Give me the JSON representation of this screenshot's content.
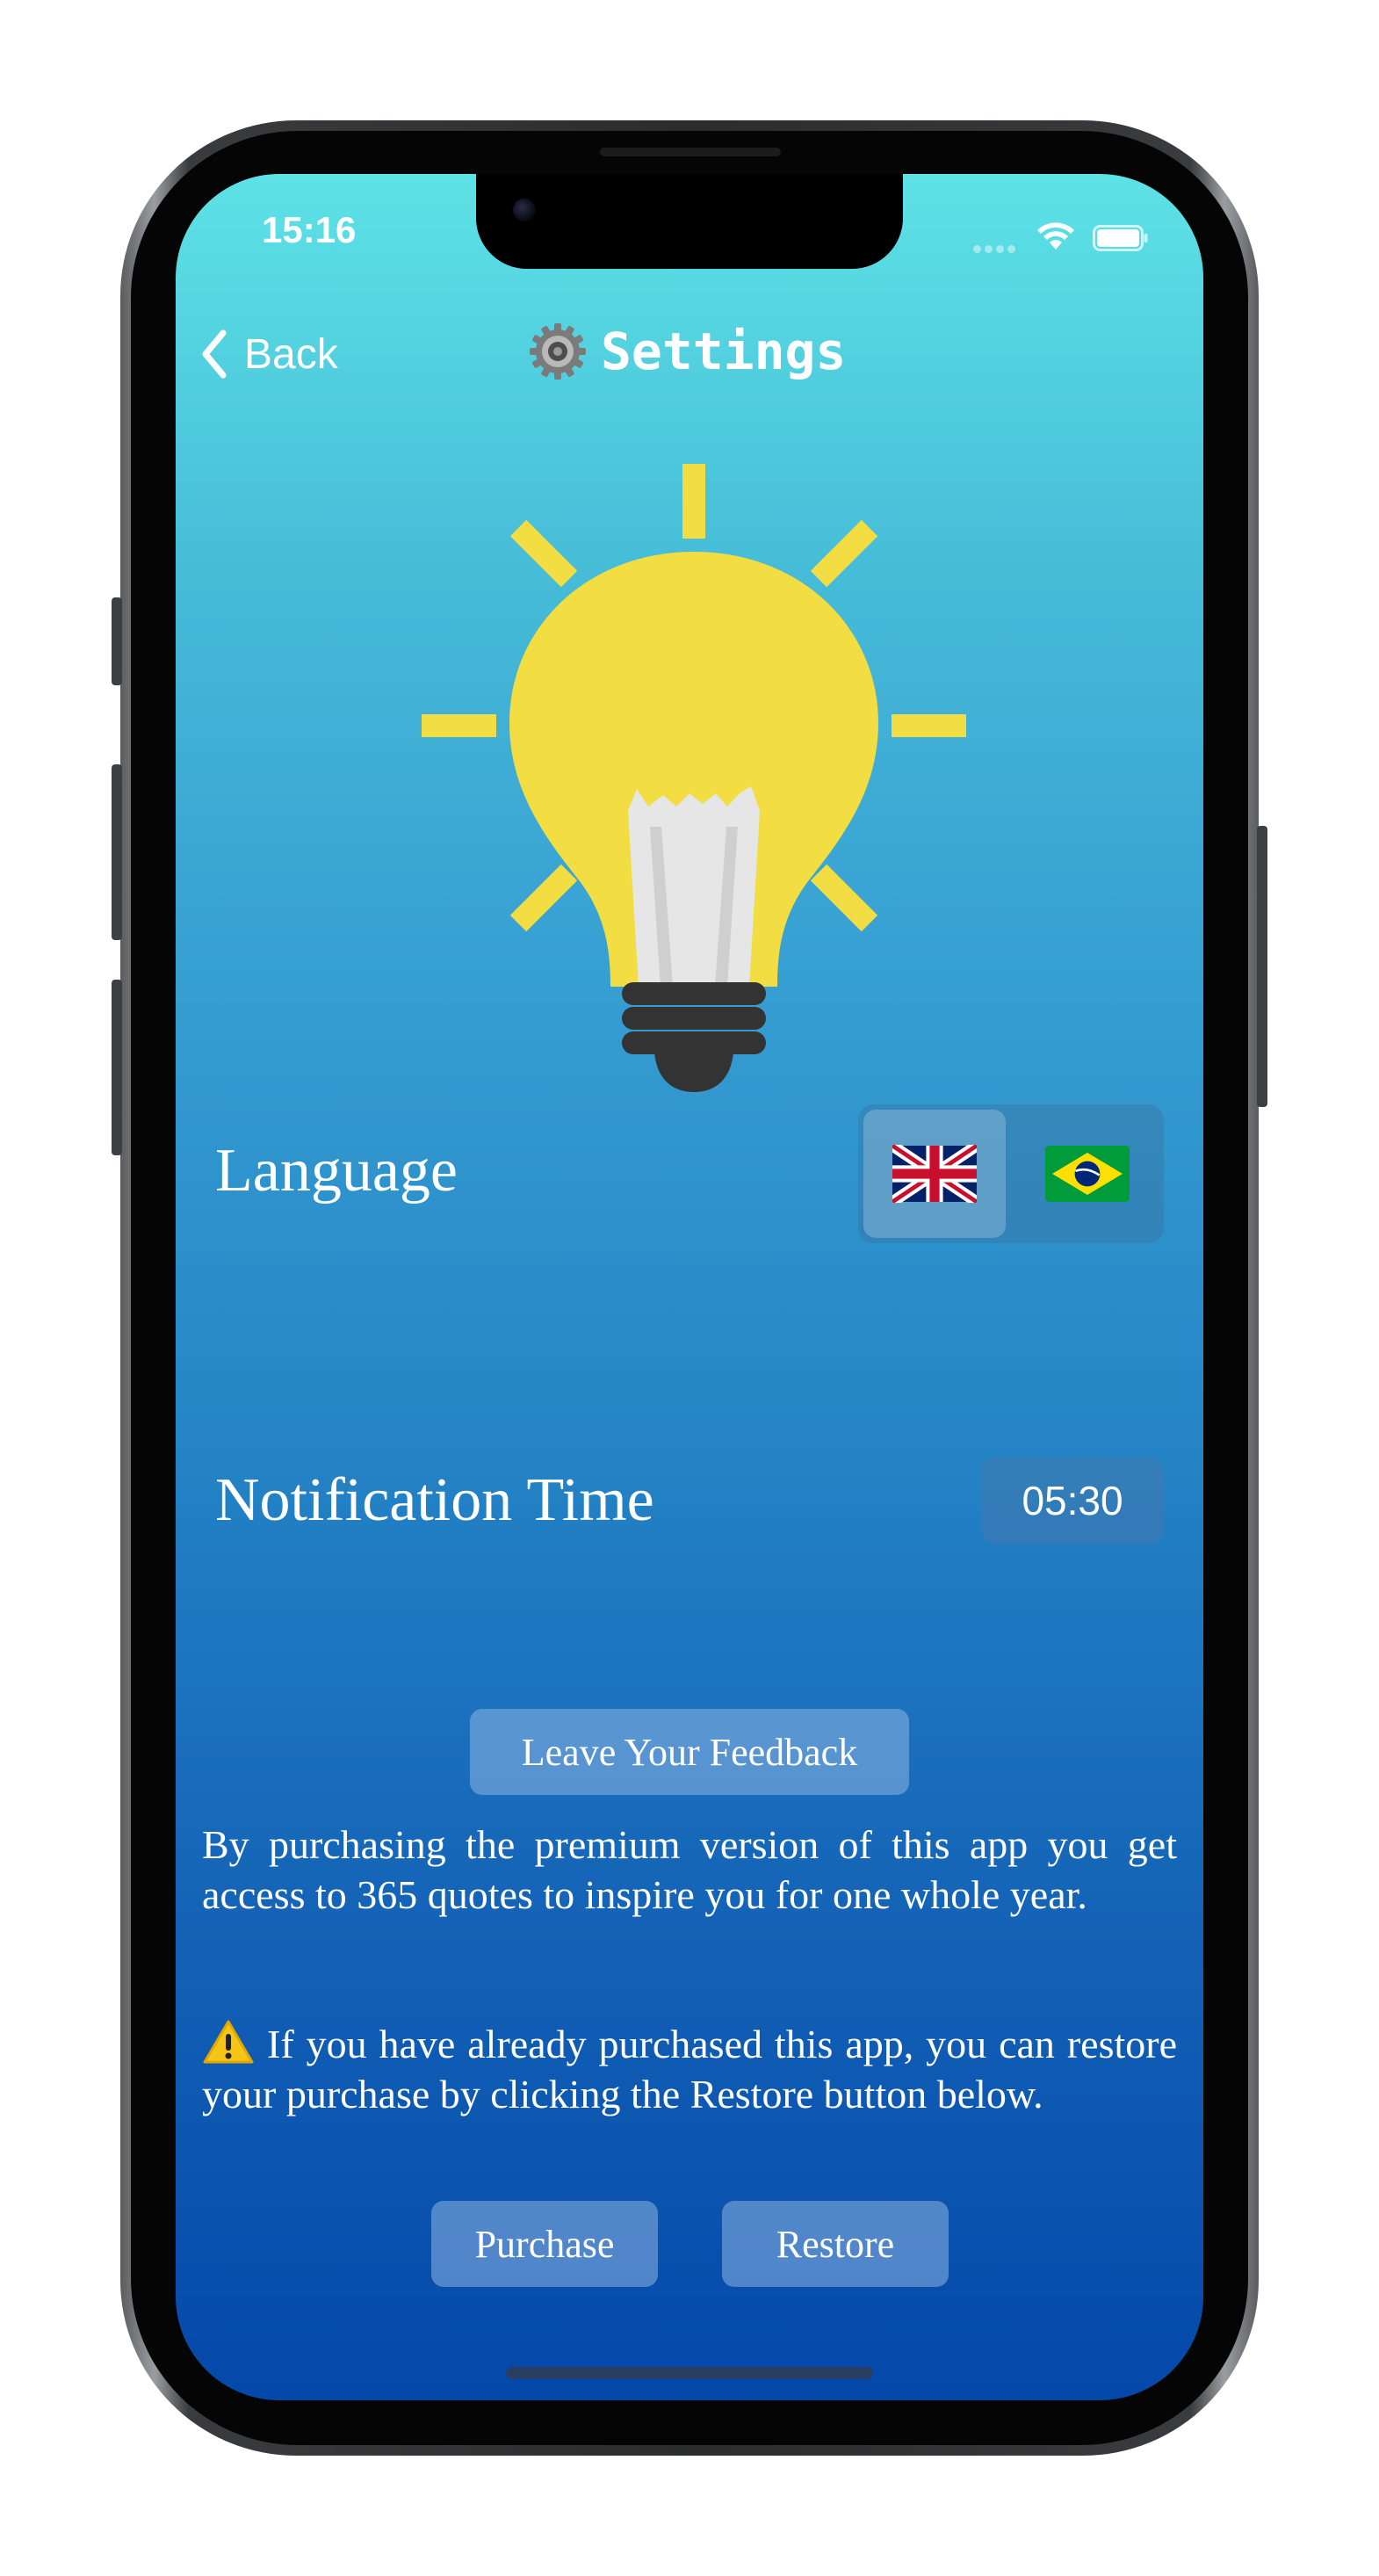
{
  "status_bar": {
    "time": "15:16"
  },
  "nav": {
    "back_label": "Back",
    "title": "Settings"
  },
  "settings": {
    "language_label": "Language",
    "languages": [
      {
        "name": "English (UK)",
        "icon": "uk-flag-icon",
        "selected": true
      },
      {
        "name": "Portuguese (Brazil)",
        "icon": "brazil-flag-icon",
        "selected": false
      }
    ],
    "notification_label": "Notification Time",
    "notification_time": "05:30"
  },
  "feedback_button": "Leave Your Feedback",
  "premium_text": "By purchasing the premium version of this app you get access to 365 quotes to inspire you for one whole year.",
  "restore_text": "If you have already purchased this app, you can restore your purchase by clicking the Restore button below.",
  "purchase_button": "Purchase",
  "restore_button": "Restore",
  "colors": {
    "gradient_top": "#5de2e6",
    "gradient_bottom": "#0448a9",
    "bulb_yellow": "#f2dd43",
    "bulb_base": "#333333"
  }
}
